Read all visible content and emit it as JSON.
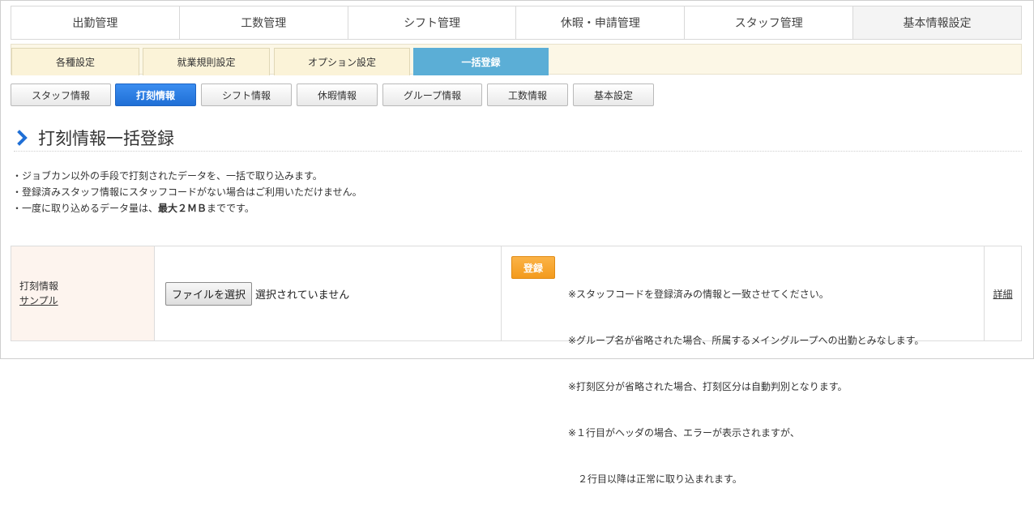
{
  "main_nav": [
    "出勤管理",
    "工数管理",
    "シフト管理",
    "休暇・申請管理",
    "スタッフ管理",
    "基本情報設定"
  ],
  "sub_nav": [
    "各種設定",
    "就業規則設定",
    "オプション設定",
    "一括登録"
  ],
  "third_nav": [
    "スタッフ情報",
    "打刻情報",
    "シフト情報",
    "休暇情報",
    "グループ情報",
    "工数情報",
    "基本設定"
  ],
  "page_title": "打刻情報一括登録",
  "notes": {
    "line1": "・ジョブカン以外の手段で打刻されたデータを、一括で取り込みます。",
    "line2": "・登録済みスタッフ情報にスタッフコードがない場合はご利用いただけません。",
    "line3_pre": "・一度に取り込めるデータ量は、",
    "line3_bold": "最大２ＭＢ",
    "line3_post": "までです。"
  },
  "table": {
    "label": "打刻情報",
    "sample_link": "サンプル",
    "file_button": "ファイルを選択",
    "file_status": "選択されていません",
    "register_button": "登録",
    "register_notes": [
      "※スタッフコードを登録済みの情報と一致させてください。",
      "※グループ名が省略された場合、所属するメイングループへの出勤とみなします。",
      "※打刻区分が省略された場合、打刻区分は自動判別となります。",
      "※１行目がヘッダの場合、エラーが表示されますが、",
      "　２行目以降は正常に取り込まれます。"
    ],
    "detail_link": "詳細"
  },
  "colors": {
    "active_sub_tab": "#5baed6",
    "active_third_tab": "#2a7fe6",
    "register_button": "#f5a42a",
    "chevron": "#1f6fd6"
  }
}
